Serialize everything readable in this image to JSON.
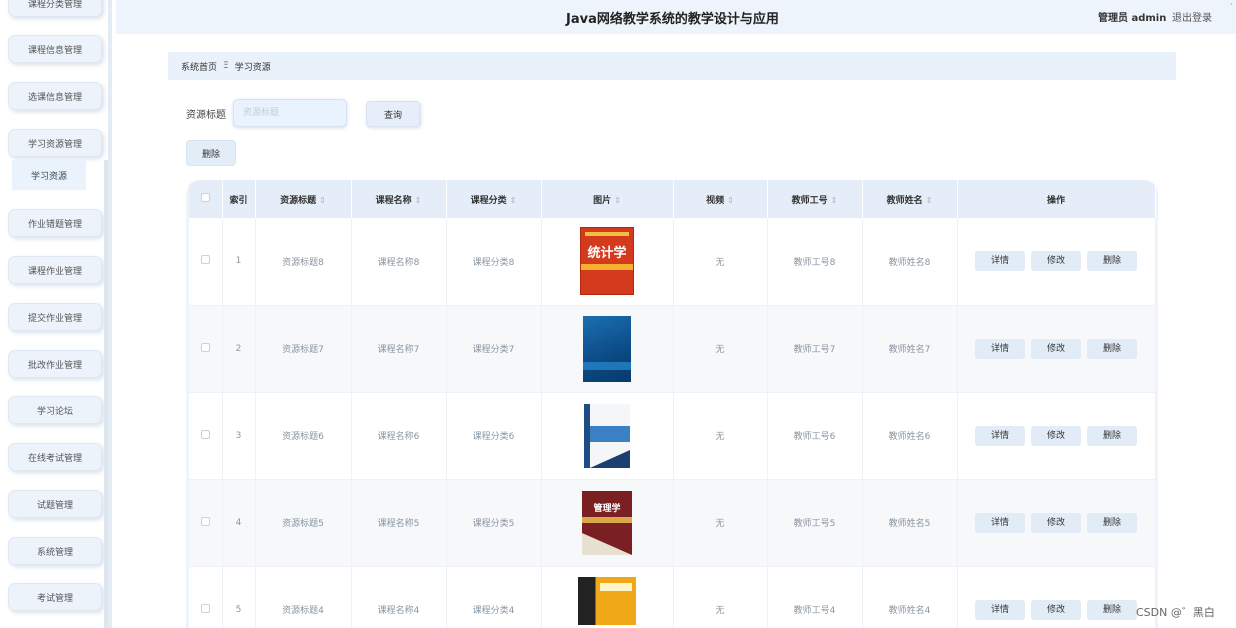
{
  "header": {
    "title": "Java网络教学系统的教学设计与应用",
    "user": "管理员 admin",
    "logout": "退出登录"
  },
  "sidebar": {
    "items": [
      {
        "label": "课程分类管理"
      },
      {
        "label": "课程信息管理"
      },
      {
        "label": "选课信息管理"
      },
      {
        "label": "学习资源管理"
      },
      {
        "label": "作业错题管理"
      },
      {
        "label": "课程作业管理"
      },
      {
        "label": "提交作业管理"
      },
      {
        "label": "批改作业管理"
      },
      {
        "label": "学习论坛"
      },
      {
        "label": "在线考试管理"
      },
      {
        "label": "试题管理"
      },
      {
        "label": "系统管理"
      },
      {
        "label": "考试管理"
      }
    ],
    "active_sub": "学习资源"
  },
  "breadcrumb": {
    "home": "系统首页",
    "separator": "Ξ",
    "current": "学习资源"
  },
  "search": {
    "label": "资源标题",
    "placeholder": "资源标题",
    "value": "",
    "query_button": "查询",
    "delete_button": "删除"
  },
  "table": {
    "headers": [
      "索引",
      "资源标题",
      "课程名称",
      "课程分类",
      "图片",
      "视频",
      "教师工号",
      "教师姓名",
      "操作"
    ],
    "rows": [
      {
        "index": "1",
        "title": "资源标题8",
        "course": "课程名称8",
        "category": "课程分类8",
        "cover_text": "统计学",
        "video": "无",
        "teacher_no": "教师工号8",
        "teacher_name": "教师姓名8"
      },
      {
        "index": "2",
        "title": "资源标题7",
        "course": "课程名称7",
        "category": "课程分类7",
        "cover_text": "",
        "video": "无",
        "teacher_no": "教师工号7",
        "teacher_name": "教师姓名7"
      },
      {
        "index": "3",
        "title": "资源标题6",
        "course": "课程名称6",
        "category": "课程分类6",
        "cover_text": "",
        "video": "无",
        "teacher_no": "教师工号6",
        "teacher_name": "教师姓名6"
      },
      {
        "index": "4",
        "title": "资源标题5",
        "course": "课程名称5",
        "category": "课程分类5",
        "cover_text": "管理学",
        "video": "无",
        "teacher_no": "教师工号5",
        "teacher_name": "教师姓名5"
      },
      {
        "index": "5",
        "title": "资源标题4",
        "course": "课程名称4",
        "category": "课程分类4",
        "cover_text": "",
        "video": "无",
        "teacher_no": "教师工号4",
        "teacher_name": "教师姓名4"
      }
    ],
    "actions": {
      "detail": "详情",
      "edit": "修改",
      "delete": "删除"
    }
  },
  "watermark": "CSDN @゛黑白",
  "edge_mark": "·"
}
